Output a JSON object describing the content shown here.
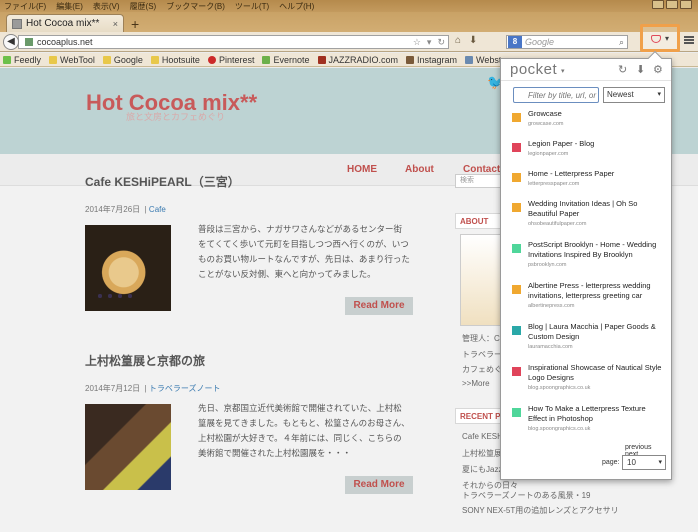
{
  "menubar": {
    "items": [
      "ファイル(F)",
      "編集(E)",
      "表示(V)",
      "履歴(S)",
      "ブックマーク(B)",
      "ツール(T)",
      "ヘルプ(H)"
    ]
  },
  "tab": {
    "title": "Hot Cocoa mix**",
    "close": "×",
    "new_tab": "+"
  },
  "navbar": {
    "url": "cocoaplus.net",
    "search_placeholder": "Google",
    "search_engine": "8"
  },
  "bookmarks": [
    {
      "label": "Feedly",
      "color": "#6cc04a"
    },
    {
      "label": "WebTool",
      "color": "#e8c84a"
    },
    {
      "label": "Google",
      "color": "#e8c84a"
    },
    {
      "label": "Hootsuite",
      "color": "#e8c84a"
    },
    {
      "label": "Pinterest",
      "color": "#cc2a2a"
    },
    {
      "label": "Evernote",
      "color": "#6cb04a"
    },
    {
      "label": "JAZZRADIO.com",
      "color": "#a03020"
    },
    {
      "label": "Instagram",
      "color": "#7a5a3a"
    },
    {
      "label": "Webstagram",
      "color": "#6a8ab0"
    }
  ],
  "site": {
    "title": "Hot Cocoa mix**",
    "subtitle": "旅と文房とカフェめぐり",
    "nav": [
      "HOME",
      "About",
      "Contact"
    ]
  },
  "posts": [
    {
      "title": "Cafe KESHiPEARL（三宮）",
      "date": "2014年7月26日",
      "category": "Cafe",
      "excerpt": "普段は三宮から、ナガサワさんなどがあるセンター街をてくてく歩いて元町を目指しつつ西へ行くのが、いつものお買い物ルートなんですが、先日は、あまり行ったことがない反対側、東へと向かってみました。",
      "read_more": "Read More"
    },
    {
      "title": "上村松篁展と京都の旅",
      "date": "2014年7月12日",
      "category": "トラベラーズノート",
      "excerpt": "先日、京都国立近代美術館で開催されていた、上村松篁展を見てきました。もともと、松篁さんのお母さん、上村松園が大好きで。４年前には、同じく、こちらの美術館で開催された上村松園展を・・・",
      "read_more": "Read More"
    }
  ],
  "sidebar": {
    "search": "検索",
    "about_head": "ABOUT",
    "about_text": [
      "管理人：Coc",
      "トラベラーズ",
      "カフェめぐりが",
      ">>More"
    ],
    "recent_head": "RECENT P",
    "recent": [
      "Cafe KESHiP",
      "上村松篁展と",
      "夏にもJazz",
      "それからの日々",
      "トラベラーズノートのある風景・19",
      "SONY NEX-5T用の追加レンズとアクセサリ"
    ]
  },
  "pocket": {
    "logo": "pocket",
    "filter_placeholder": "Filter by title, url, or",
    "sort": "Newest",
    "items": [
      {
        "title": "Growcase",
        "domain": "growcase.com",
        "color": "#f0a830"
      },
      {
        "title": "Legion Paper - Blog",
        "domain": "legionpaper.com",
        "color": "#e0445a"
      },
      {
        "title": "Home - Letterpress Paper",
        "domain": "letterpresspaper.com",
        "color": "#f0a830"
      },
      {
        "title": "Wedding Invitation Ideas | Oh So Beautiful Paper",
        "domain": "ohsobeautifulpaper.com",
        "color": "#f0a830"
      },
      {
        "title": "PostScript Brooklyn - Home - Wedding Invitations Inspired By Brooklyn",
        "domain": "psbrooklyn.com",
        "color": "#4fd69a"
      },
      {
        "title": "Albertine Press - letterpress wedding invitations, letterpress greeting car",
        "domain": "albertinepress.com",
        "color": "#f0a830"
      },
      {
        "title": "Blog | Laura Macchia | Paper Goods & Custom Design",
        "domain": "lauramacchia.com",
        "color": "#2aa8a8"
      },
      {
        "title": "Inspirational Showcase of Nautical Style Logo Designs",
        "domain": "blog.spoongraphics.co.uk",
        "color": "#e0445a"
      },
      {
        "title": "How To Make a Letterpress Texture Effect in Photoshop",
        "domain": "blog.spoongraphics.co.uk",
        "color": "#4fd69a"
      }
    ],
    "previous": "previous",
    "next": "next",
    "page_label": "page:",
    "page_value": "10"
  }
}
